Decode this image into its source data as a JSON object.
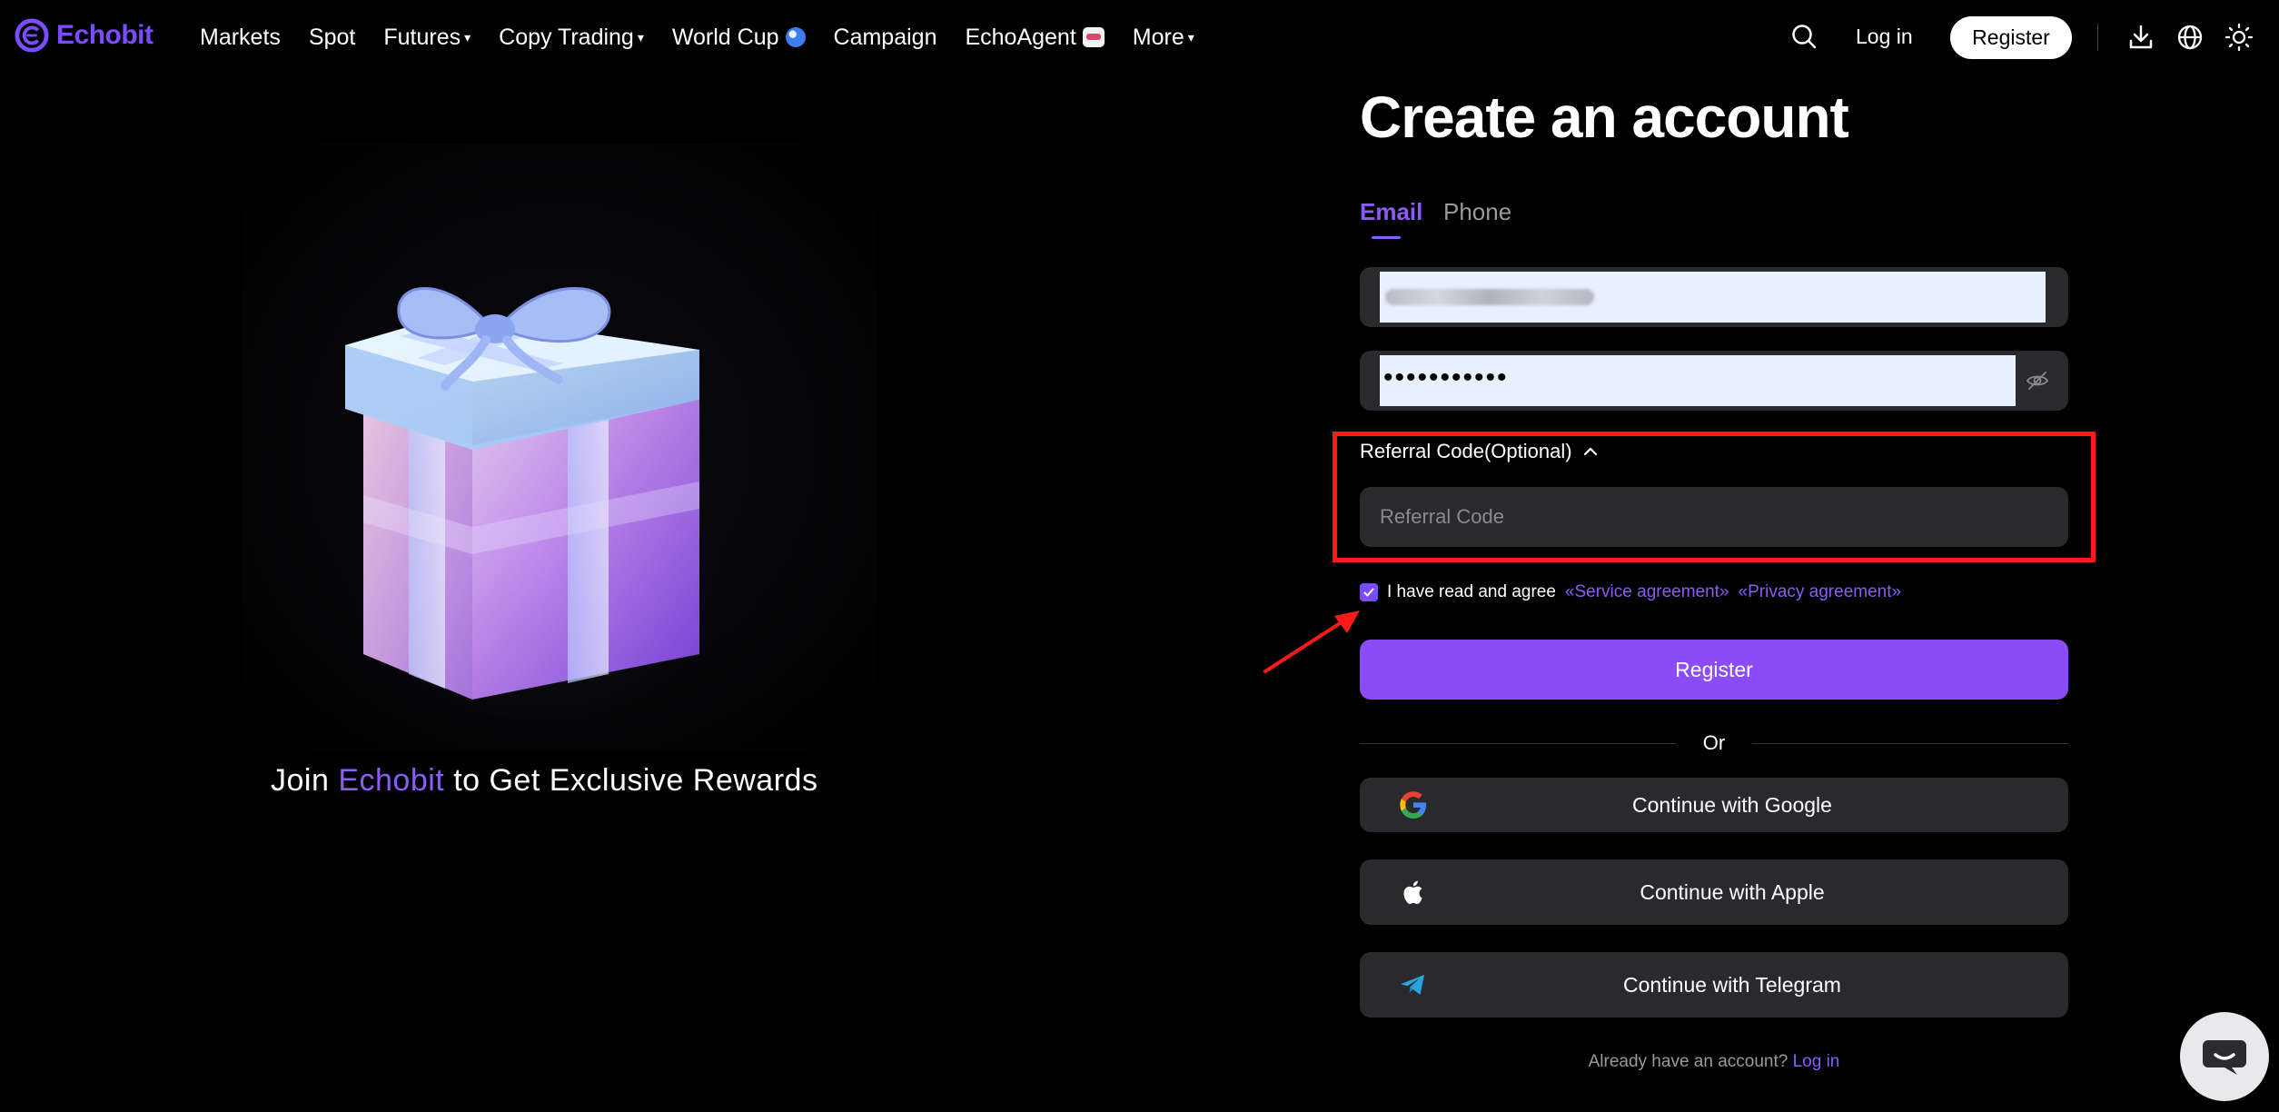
{
  "nav": {
    "logo_text": "Echobit",
    "links": {
      "markets": "Markets",
      "spot": "Spot",
      "futures": "Futures",
      "copy_trading": "Copy Trading",
      "world_cup": "World Cup",
      "campaign": "Campaign",
      "echoagent": "EchoAgent",
      "more": "More"
    },
    "caret": "▾",
    "login": "Log in",
    "register": "Register"
  },
  "hero": {
    "caption_prefix": "Join",
    "caption_brand": "Echobit",
    "caption_suffix": "to Get Exclusive Rewards"
  },
  "form": {
    "title": "Create an account",
    "tabs": {
      "email": "Email",
      "phone": "Phone",
      "active": "email"
    },
    "password_mask": "•••••••••••",
    "referral_toggle": "Referral Code(Optional)",
    "referral_placeholder": "Referral Code",
    "agree_checked": true,
    "agree_text": "I have read and agree",
    "service_link": "«Service agreement»",
    "privacy_link": "«Privacy agreement»",
    "register_button": "Register",
    "or_text": "Or",
    "google": "Continue with Google",
    "apple": "Continue with Apple",
    "telegram": "Continue with Telegram",
    "have_account": "Already have an account?",
    "login_link": "Log in"
  },
  "icons": {
    "search": "search-icon",
    "download": "download-icon",
    "language": "globe-icon",
    "theme": "sun-icon",
    "password_toggle": "eye-off-icon",
    "chat": "chat-icon"
  },
  "colors": {
    "accent": "#8b5cf6",
    "register_button": "#8b4cf7",
    "field_bg": "#2a2a2e",
    "autofill_bg": "#e8f0fe",
    "annotation_red": "#ff1a1a",
    "background": "#000000"
  }
}
